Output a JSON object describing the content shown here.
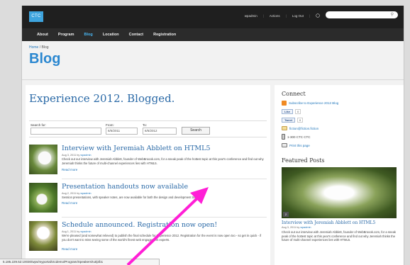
{
  "logo": {
    "text": "CTC"
  },
  "topbar": {
    "user": "wpadmin",
    "actions": "Actions",
    "logout": "Log Out",
    "sep": "|"
  },
  "nav": [
    "About",
    "Program",
    "Blog",
    "Location",
    "Contact",
    "Registration"
  ],
  "breadcrumb": {
    "home": "Home",
    "sep": " / ",
    "current": "Blog"
  },
  "page_title": "Blog",
  "content": {
    "heading": "Experience 2012. Blogged.",
    "search": {
      "search_label": "Search for:",
      "from_label": "From:",
      "from_value": "6/6/2011",
      "to_label": "To:",
      "to_value": "6/6/2012",
      "button": "Search"
    },
    "posts": [
      {
        "title": "Interview with Jeremiah Abblett on HTML5",
        "meta_prefix": "Aug 3, 2011 by ",
        "author": "wpadmin",
        "excerpt": "Check out our interview with Jeremiah Abblett, founder of WebBroook.com, for a sneak peak of the hottest topic at this year's conference and find out why Jeremiah thinks the future of multi-channel experiences lies with HTML5.",
        "more": "Read more"
      },
      {
        "title": "Presentation handouts now available",
        "meta_prefix": "Aug 2, 2011 by ",
        "author": "wpadmin",
        "excerpt": "Session presentations, with speaker notes, are now available for both the design and development tracks.",
        "more": "Read more"
      },
      {
        "title": "Schedule announced. Registration now open!",
        "meta_prefix": "Aug 1, 2011 by ",
        "author": "wpadmin",
        "excerpt": "We're pleased (and somewhat relieved) to publish the final schedule for Experience 2012. Registration for the event is now open too - so get in quick - if you don't want to miss seeing some of the world's finest web engagement experts.",
        "more": "Read more"
      }
    ]
  },
  "sidebar": {
    "connect_heading": "Connect",
    "subscribe": "Subscribe to Experience 2012 Blog",
    "like_label": "Like",
    "like_count": "0",
    "tweet_label": "Tweet",
    "tweet_count": "0",
    "email": "fiction@fiction.fiction",
    "phone": "1-300 CTC CTC",
    "print": "Print this page",
    "featured_heading": "Featured Posts",
    "featured": {
      "badge": "2",
      "title": "Interview with Jeremiah Abblett on HTML5",
      "meta_prefix": "Aug 3, 2011 by ",
      "author": "wpadmin",
      "excerpt": "Check out our interview with Jeremiah Abblett, founder of WebBroook.com, for a sneak peak of the hottest topic at this year's conference and find out why Jeremiah thinks the future of multi-channel experiences lies with HTML5."
    }
  },
  "statusbar": "5.185.229.52:10030/wps/myportal/ctcdemo/Program/Speakers/!ut/p/b1",
  "colors": {
    "accent": "#2a87d0",
    "nav_active": "#49b4ef",
    "annotation_arrow": "#ff1fd6"
  }
}
